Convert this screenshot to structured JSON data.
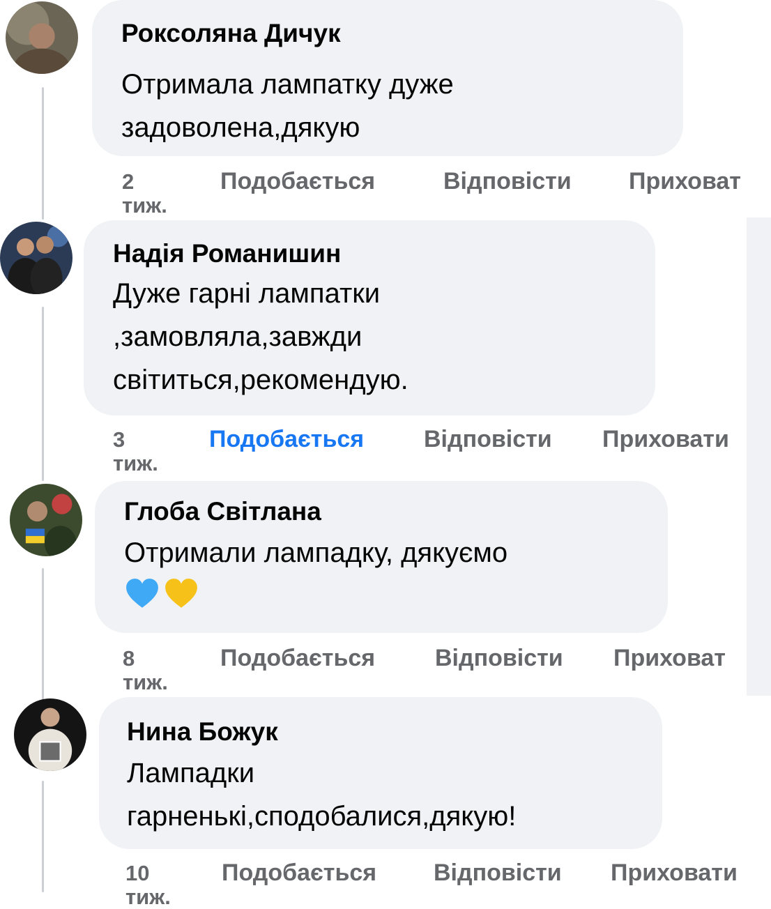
{
  "comments": [
    {
      "author": "Роксоляна Дичук",
      "text": "Отримала лампатку дуже\nзадоволена,дякую",
      "time": "2\nтиж.",
      "like": "Подобається",
      "reply": "Відповісти",
      "hide": "Приховат",
      "liked": false
    },
    {
      "author": "Надія Романишин",
      "text": "Дуже гарні лампатки\n,замовляла,завжди\nсвітиться,рекомендую.",
      "time": "3\nтиж.",
      "like": "Подобається",
      "reply": "Відповісти",
      "hide": "Приховати",
      "liked": true
    },
    {
      "author": "Глоба Світлана",
      "text": "Отримали лампадку, дякуємо",
      "emojis": [
        "blue-heart",
        "yellow-heart"
      ],
      "time": "8\nтиж.",
      "like": "Подобається",
      "reply": "Відповісти",
      "hide": "Приховат",
      "liked": false
    },
    {
      "author": "Нина Божук",
      "text": "Лампадки\nгарненькі,сподобалися,дякую!",
      "time": "10\nтиж.",
      "like": "Подобається",
      "reply": "Відповісти",
      "hide": "Приховати",
      "liked": false
    }
  ],
  "colors": {
    "bubble": "#f0f2f5",
    "text": "#050505",
    "meta": "#65676b",
    "liked": "#1877f2"
  }
}
